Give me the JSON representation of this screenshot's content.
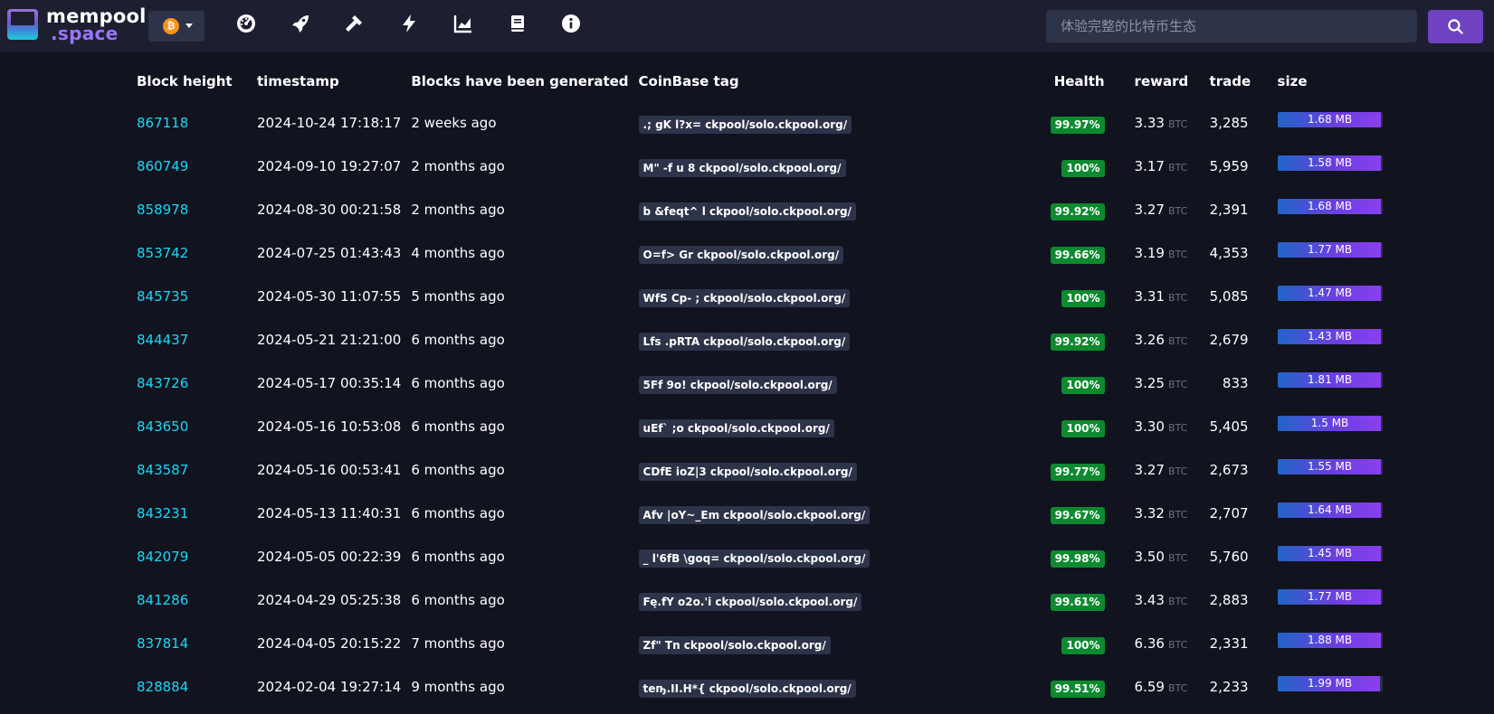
{
  "header": {
    "logo_line1": "mempool",
    "logo_line2": ".space",
    "network_coin": "₿",
    "nav_icons": [
      "dashboard-icon",
      "rocket-icon",
      "hammer-icon",
      "lightning-icon",
      "chart-icon",
      "book-icon",
      "info-icon"
    ],
    "search_placeholder": "体验完整的比特币生态",
    "accent": "#6f42c1"
  },
  "table": {
    "columns": [
      "Block height",
      "timestamp",
      "Blocks have been generated",
      "CoinBase tag",
      "Health",
      "reward",
      "trade",
      "size"
    ],
    "btc_unit": "BTC",
    "rows": [
      {
        "height": "867118",
        "timestamp": "2024-10-24 17:18:17",
        "age": "2 weeks ago",
        "tag": ".; gK l?x= ckpool/solo.ckpool.org/",
        "health": "99.97%",
        "reward": "3.33",
        "trade": "3,285",
        "size": "1.68 MB",
        "size_fill": 0.99
      },
      {
        "height": "860749",
        "timestamp": "2024-09-10 19:27:07",
        "age": "2 months ago",
        "tag": "M\" -f u 8 ckpool/solo.ckpool.org/",
        "health": "100%",
        "reward": "3.17",
        "trade": "5,959",
        "size": "1.58 MB",
        "size_fill": 0.99
      },
      {
        "height": "858978",
        "timestamp": "2024-08-30 00:21:58",
        "age": "2 months ago",
        "tag": "b &feqt^ l ckpool/solo.ckpool.org/",
        "health": "99.92%",
        "reward": "3.27",
        "trade": "2,391",
        "size": "1.68 MB",
        "size_fill": 0.99
      },
      {
        "height": "853742",
        "timestamp": "2024-07-25 01:43:43",
        "age": "4 months ago",
        "tag": " O=f> Gr ckpool/solo.ckpool.org/",
        "health": "99.66%",
        "reward": "3.19",
        "trade": "4,353",
        "size": "1.77 MB",
        "size_fill": 0.99
      },
      {
        "height": "845735",
        "timestamp": "2024-05-30 11:07:55",
        "age": "5 months ago",
        "tag": "WfS Cp- ; ckpool/solo.ckpool.org/",
        "health": "100%",
        "reward": "3.31",
        "trade": "5,085",
        "size": "1.47 MB",
        "size_fill": 0.99
      },
      {
        "height": "844437",
        "timestamp": "2024-05-21 21:21:00",
        "age": "6 months ago",
        "tag": "Lfs .pRTA ckpool/solo.ckpool.org/",
        "health": "99.92%",
        "reward": "3.26",
        "trade": "2,679",
        "size": "1.43 MB",
        "size_fill": 0.99
      },
      {
        "height": "843726",
        "timestamp": "2024-05-17 00:35:14",
        "age": "6 months ago",
        "tag": "5Ff 9o! ckpool/solo.ckpool.org/",
        "health": "100%",
        "reward": "3.25",
        "trade": "833",
        "size": "1.81 MB",
        "size_fill": 0.99
      },
      {
        "height": "843650",
        "timestamp": "2024-05-16 10:53:08",
        "age": "6 months ago",
        "tag": " uEf` ;o ckpool/solo.ckpool.org/",
        "health": "100%",
        "reward": "3.30",
        "trade": "5,405",
        "size": "1.5 MB",
        "size_fill": 0.99
      },
      {
        "height": "843587",
        "timestamp": "2024-05-16 00:53:41",
        "age": "6 months ago",
        "tag": "CDfE ioZ|3 ckpool/solo.ckpool.org/",
        "health": "99.77%",
        "reward": "3.27",
        "trade": "2,673",
        "size": "1.55 MB",
        "size_fill": 0.99
      },
      {
        "height": "843231",
        "timestamp": "2024-05-13 11:40:31",
        "age": "6 months ago",
        "tag": "Afv |oY~_Em ckpool/solo.ckpool.org/",
        "health": "99.67%",
        "reward": "3.32",
        "trade": "2,707",
        "size": "1.64 MB",
        "size_fill": 0.99
      },
      {
        "height": "842079",
        "timestamp": "2024-05-05 00:22:39",
        "age": "6 months ago",
        "tag": "_ l'6fB \\goq= ckpool/solo.ckpool.org/",
        "health": "99.98%",
        "reward": "3.50",
        "trade": "5,760",
        "size": "1.45 MB",
        "size_fill": 0.99
      },
      {
        "height": "841286",
        "timestamp": "2024-04-29 05:25:38",
        "age": "6 months ago",
        "tag": "Fę.fY o2o.'i ckpool/solo.ckpool.org/",
        "health": "99.61%",
        "reward": "3.43",
        "trade": "2,883",
        "size": "1.77 MB",
        "size_fill": 0.99
      },
      {
        "height": "837814",
        "timestamp": "2024-04-05 20:15:22",
        "age": "7 months ago",
        "tag": " Zf\" Tn ckpool/solo.ckpool.org/",
        "health": "100%",
        "reward": "6.36",
        "trade": "2,331",
        "size": "1.88 MB",
        "size_fill": 0.99
      },
      {
        "height": "828884",
        "timestamp": "2024-02-04 19:27:14",
        "age": "9 months ago",
        "tag": "teҧ.II.H*{ ckpool/solo.ckpool.org/",
        "health": "99.51%",
        "reward": "6.59",
        "trade": "2,233",
        "size": "1.99 MB",
        "size_fill": 0.98
      }
    ]
  }
}
